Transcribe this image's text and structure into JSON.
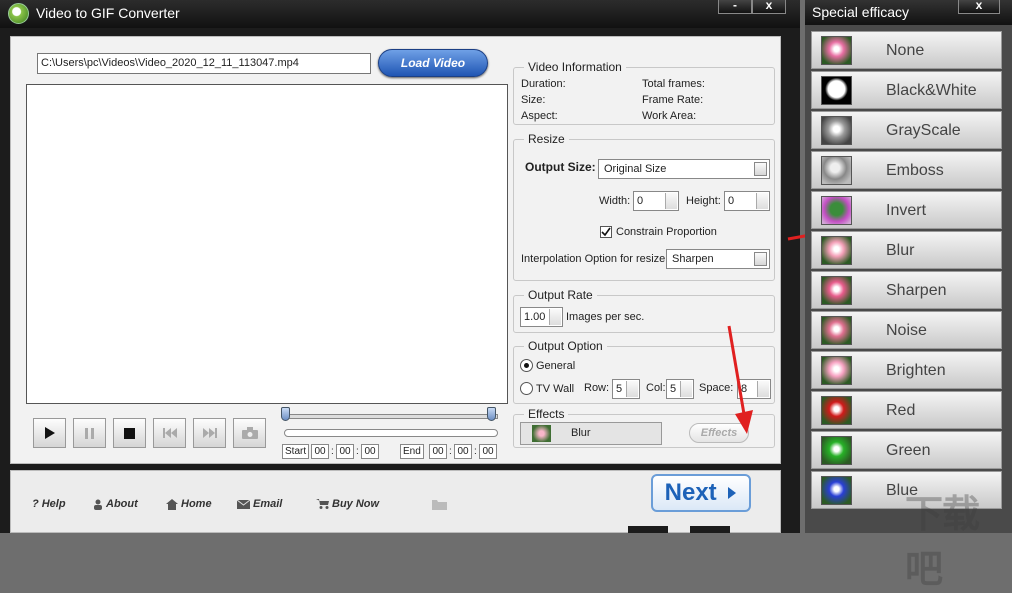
{
  "window": {
    "title": "Video to GIF Converter",
    "minimize_label": "-",
    "close_label": "x"
  },
  "load": {
    "path_value": "C:\\Users\\pc\\Videos\\Video_2020_12_11_113047.mp4",
    "load_button_label": "Load Video"
  },
  "timeline": {
    "start_label": "Start",
    "end_label": "End",
    "start_time": [
      "00",
      "00",
      "00"
    ],
    "end_time": [
      "00",
      "00",
      "00"
    ]
  },
  "video_info": {
    "title": "Video Information",
    "duration_label": "Duration:",
    "size_label": "Size:",
    "aspect_label": "Aspect:",
    "total_frames_label": "Total frames:",
    "frame_rate_label": "Frame Rate:",
    "work_area_label": "Work Area:"
  },
  "resize": {
    "title": "Resize",
    "output_size_label": "Output Size:",
    "output_size_value": "Original Size",
    "width_label": "Width:",
    "width_value": "0",
    "height_label": "Height:",
    "height_value": "0",
    "constrain_label": "Constrain Proportion",
    "constrain_checked": true,
    "interpolation_label": "Interpolation Option for resize:",
    "interpolation_value": "Sharpen"
  },
  "output_rate": {
    "title": "Output Rate",
    "value": "1.00",
    "unit_label": "Images per sec."
  },
  "output_option": {
    "title": "Output Option",
    "general_label": "General",
    "general_selected": true,
    "tvwall_label": "TV Wall",
    "row_label": "Row:",
    "row_value": "5",
    "col_label": "Col:",
    "col_value": "5",
    "space_label": "Space:",
    "space_value": "8"
  },
  "effects": {
    "title": "Effects",
    "current": "Blur",
    "button_label": "Effects"
  },
  "next_label": "Next",
  "footer": {
    "help": "Help",
    "about": "About",
    "home": "Home",
    "email": "Email",
    "buy_now": "Buy Now"
  },
  "fx_panel": {
    "title": "Special efficacy",
    "close_label": "x",
    "items": [
      {
        "label": "None",
        "color": "#e86fa3"
      },
      {
        "label": "Black&White",
        "color": "#000000"
      },
      {
        "label": "GrayScale",
        "color": "#8a8a8a"
      },
      {
        "label": "Emboss",
        "color": "#b0b0b0"
      },
      {
        "label": "Invert",
        "color": "#3d7a3a"
      },
      {
        "label": "Blur",
        "color": "#f4a0b8"
      },
      {
        "label": "Sharpen",
        "color": "#e85c8c"
      },
      {
        "label": "Noise",
        "color": "#e07090"
      },
      {
        "label": "Brighten",
        "color": "#f7a2c2"
      },
      {
        "label": "Red",
        "color": "#d11a1a"
      },
      {
        "label": "Green",
        "color": "#27b127"
      },
      {
        "label": "Blue",
        "color": "#2a3fd6"
      }
    ]
  },
  "watermark": "下载吧"
}
